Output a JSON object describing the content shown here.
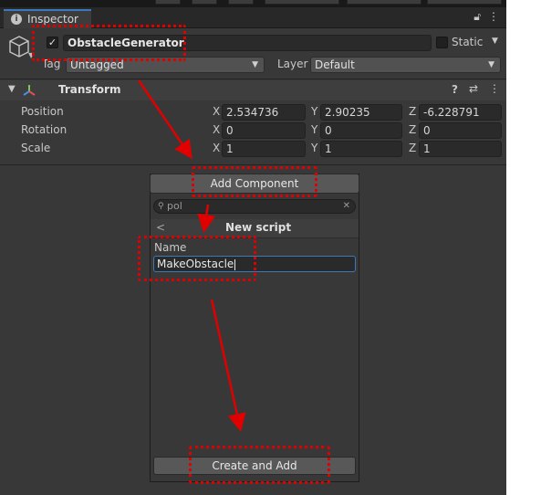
{
  "tab": {
    "title": "Inspector",
    "icons": [
      "lock-icon",
      "menu-icon"
    ]
  },
  "object": {
    "name": "ObstacleGenerator",
    "active": true,
    "static_label": "Static",
    "tag_label": "Tag",
    "tag_value": "Untagged",
    "layer_label": "Layer",
    "layer_value": "Default"
  },
  "transform": {
    "title": "Transform",
    "rows": [
      {
        "label": "Position",
        "x": "2.534736",
        "y": "2.90235",
        "z": "-6.228791"
      },
      {
        "label": "Rotation",
        "x": "0",
        "y": "0",
        "z": "0"
      },
      {
        "label": "Scale",
        "x": "1",
        "y": "1",
        "z": "1"
      }
    ],
    "axis": {
      "x": "X",
      "y": "Y",
      "z": "Z"
    }
  },
  "add_component": {
    "button_label": "Add Component",
    "search_value": "pol",
    "panel_title": "New script",
    "back_glyph": "<",
    "name_label": "Name",
    "name_value": "MakeObstacle",
    "create_label": "Create and Add"
  },
  "colors": {
    "highlight": "#e00000",
    "accent": "#3a79bb",
    "panel": "#383838"
  }
}
